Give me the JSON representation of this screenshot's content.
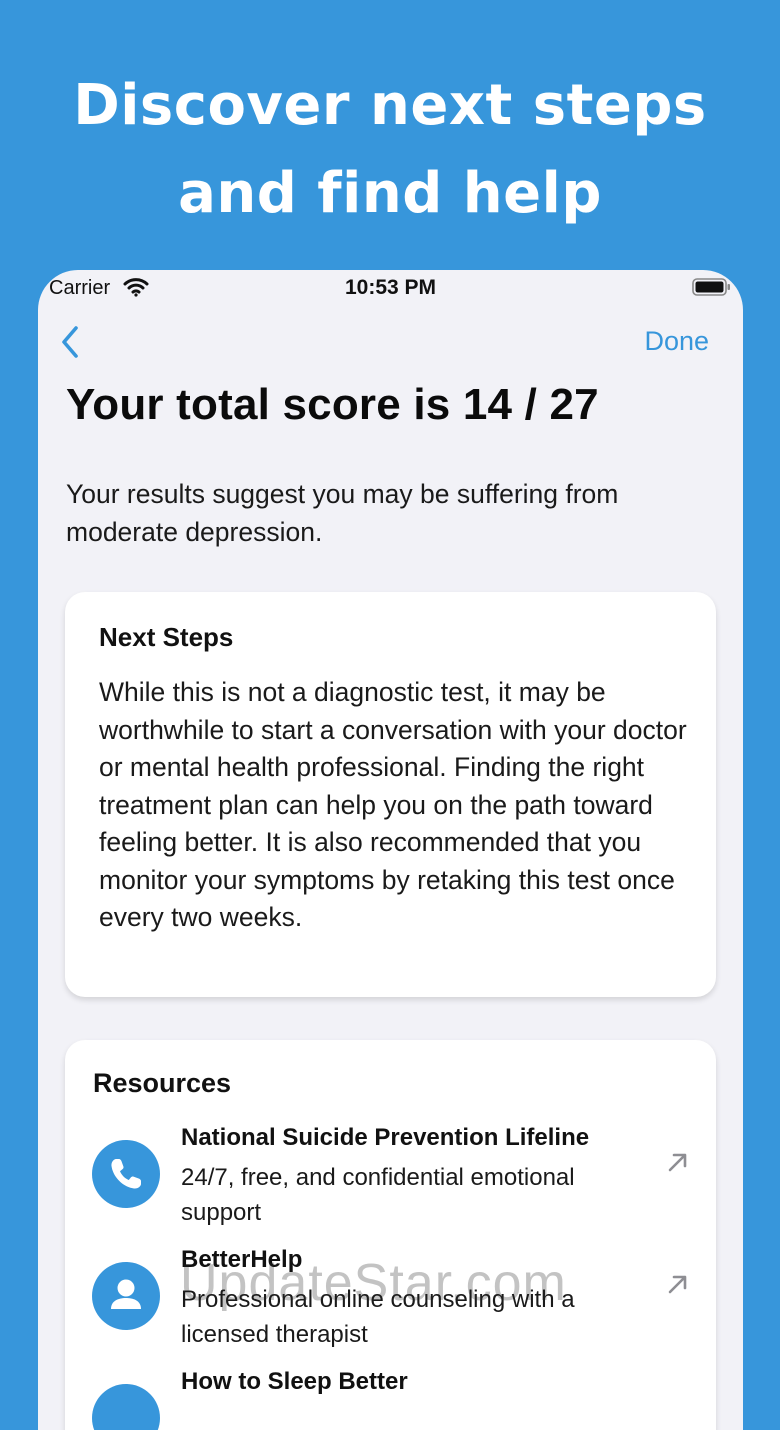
{
  "hero": {
    "line1": "Discover next steps",
    "line2": "and find help"
  },
  "status_bar": {
    "carrier": "Carrier",
    "time": "10:53 PM"
  },
  "nav": {
    "done_label": "Done"
  },
  "title": "Your total score is 14 / 27",
  "summary": "Your results suggest you may be suffering from moderate depression.",
  "next_steps": {
    "title": "Next Steps",
    "body": "While this is not a diagnostic test, it may be worthwhile to start a conversation with your doctor or mental health professional. Finding the right treatment plan can help you on the path toward feeling better. It is also recommended that you monitor your symptoms by retaking this test once every two weeks."
  },
  "resources": {
    "title": "Resources",
    "items": [
      {
        "name": "National Suicide Prevention Lifeline",
        "description": "24/7, free, and confidential emotional support",
        "icon": "phone-icon"
      },
      {
        "name": "BetterHelp",
        "description": "Professional online counseling with a licensed therapist",
        "icon": "person-icon"
      },
      {
        "name": "How to Sleep Better",
        "description": "",
        "icon": "moon-icon"
      }
    ]
  },
  "watermark": "UpdateStar.com",
  "colors": {
    "accent": "#3796db",
    "background": "#3796db",
    "screen": "#f2f2f7",
    "card": "#ffffff"
  }
}
